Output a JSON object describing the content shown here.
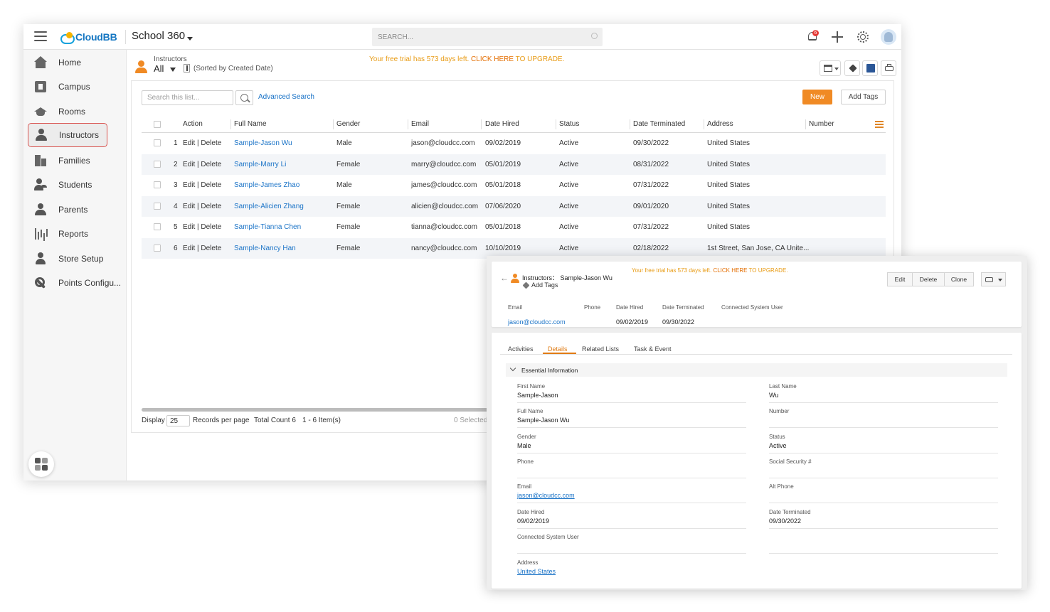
{
  "main": {
    "app_logo": "CloudBB",
    "app_name": "School 360",
    "search_placeholder": "SEARCH...",
    "notification_count": "6",
    "nav": [
      {
        "label": "Home",
        "icon": "home-icon"
      },
      {
        "label": "Campus",
        "icon": "campus-icon"
      },
      {
        "label": "Rooms",
        "icon": "graduation-cap-icon"
      },
      {
        "label": "Instructors",
        "icon": "person-icon",
        "active": true
      },
      {
        "label": "Families",
        "icon": "building-icon"
      },
      {
        "label": "Students",
        "icon": "students-icon"
      },
      {
        "label": "Parents",
        "icon": "person-icon"
      },
      {
        "label": "Reports",
        "icon": "bar-chart-icon"
      },
      {
        "label": "Store Setup",
        "icon": "person-icon"
      },
      {
        "label": "Points Configu...",
        "icon": "wrench-icon"
      }
    ],
    "list": {
      "object_label": "Instructors",
      "view_name": "All",
      "sort_text": "(Sorted by Created Date)",
      "trial_text": "Your free trial has 573 days left. ",
      "trial_link_bold": "CLICK HERE",
      "trial_link_rest": " TO UPGRADE.",
      "search_placeholder": "Search this list...",
      "advanced_search": "Advanced Search",
      "new_button": "New",
      "add_tags_button": "Add Tags",
      "columns": [
        "Action",
        "Full Name",
        "Gender",
        "Email",
        "Date Hired",
        "Status",
        "Date Terminated",
        "Address",
        "Number"
      ],
      "rows": [
        {
          "num": "1",
          "action": "Edit | Delete",
          "name": "Sample-Jason Wu",
          "gender": "Male",
          "email": "jason@cloudcc.com",
          "hired": "09/02/2019",
          "status": "Active",
          "terminated": "09/30/2022",
          "address": "United States",
          "number": ""
        },
        {
          "num": "2",
          "action": "Edit | Delete",
          "name": "Sample-Marry Li",
          "gender": "Female",
          "email": "marry@cloudcc.com",
          "hired": "05/01/2019",
          "status": "Active",
          "terminated": "08/31/2022",
          "address": "United States",
          "number": ""
        },
        {
          "num": "3",
          "action": "Edit | Delete",
          "name": "Sample-James Zhao",
          "gender": "Male",
          "email": "james@cloudcc.com",
          "hired": "05/01/2018",
          "status": "Active",
          "terminated": "07/31/2022",
          "address": "United States",
          "number": ""
        },
        {
          "num": "4",
          "action": "Edit | Delete",
          "name": "Sample-Alicien Zhang",
          "gender": "Female",
          "email": "alicien@cloudcc.com",
          "hired": "07/06/2020",
          "status": "Active",
          "terminated": "09/01/2020",
          "address": "United States",
          "number": ""
        },
        {
          "num": "5",
          "action": "Edit | Delete",
          "name": "Sample-Tianna Chen",
          "gender": "Female",
          "email": "tianna@cloudcc.com",
          "hired": "05/01/2018",
          "status": "Active",
          "terminated": "07/31/2022",
          "address": "United States",
          "number": ""
        },
        {
          "num": "6",
          "action": "Edit | Delete",
          "name": "Sample-Nancy Han",
          "gender": "Female",
          "email": "nancy@cloudcc.com",
          "hired": "10/10/2019",
          "status": "Active",
          "terminated": "02/18/2022",
          "address": "1st Street, San Jose, CA Unite...",
          "number": ""
        }
      ],
      "footer": {
        "display_label": "Display",
        "per_page": "25",
        "per_page_label": "Records per page",
        "total": "Total Count 6",
        "range": "1 - 6 Item(s)",
        "selected": "0 Selected"
      }
    }
  },
  "detail": {
    "title_object": "Instructors：",
    "title_name": "Sample-Jason Wu",
    "add_tags": "Add Tags",
    "trial_text": "Your free trial has 573 days left. ",
    "trial_link_bold": "CLICK HERE",
    "trial_link_rest": " TO UPGRADE.",
    "buttons": {
      "edit": "Edit",
      "delete": "Delete",
      "clone": "Clone"
    },
    "highlights": {
      "email_label": "Email",
      "email_value": "jason@cloudcc.com",
      "phone_label": "Phone",
      "phone_value": "",
      "hired_label": "Date Hired",
      "hired_value": "09/02/2019",
      "terminated_label": "Date Terminated",
      "terminated_value": "09/30/2022",
      "csu_label": "Connected System User",
      "csu_value": ""
    },
    "tabs": [
      "Activities",
      "Details",
      "Related Lists",
      "Task & Event"
    ],
    "section_title": "Essential Information",
    "fields": {
      "first_name_label": "First Name",
      "first_name": "Sample-Jason",
      "last_name_label": "Last Name",
      "last_name": "Wu",
      "full_name_label": "Full Name",
      "full_name": "Sample-Jason Wu",
      "number_label": "Number",
      "number": "",
      "gender_label": "Gender",
      "gender": "Male",
      "status_label": "Status",
      "status": "Active",
      "phone_label": "Phone",
      "phone": "",
      "ssn_label": "Social Security #",
      "ssn": "",
      "email_label": "Email",
      "email": "jason@cloudcc.com",
      "alt_phone_label": "Alt Phone",
      "alt_phone": "",
      "hired_label": "Date Hired",
      "hired": "09/02/2019",
      "terminated_label": "Date Terminated",
      "terminated": "09/30/2022",
      "csu_label": "Connected System User",
      "csu": "",
      "address_label": "Address",
      "address": "United States"
    }
  }
}
